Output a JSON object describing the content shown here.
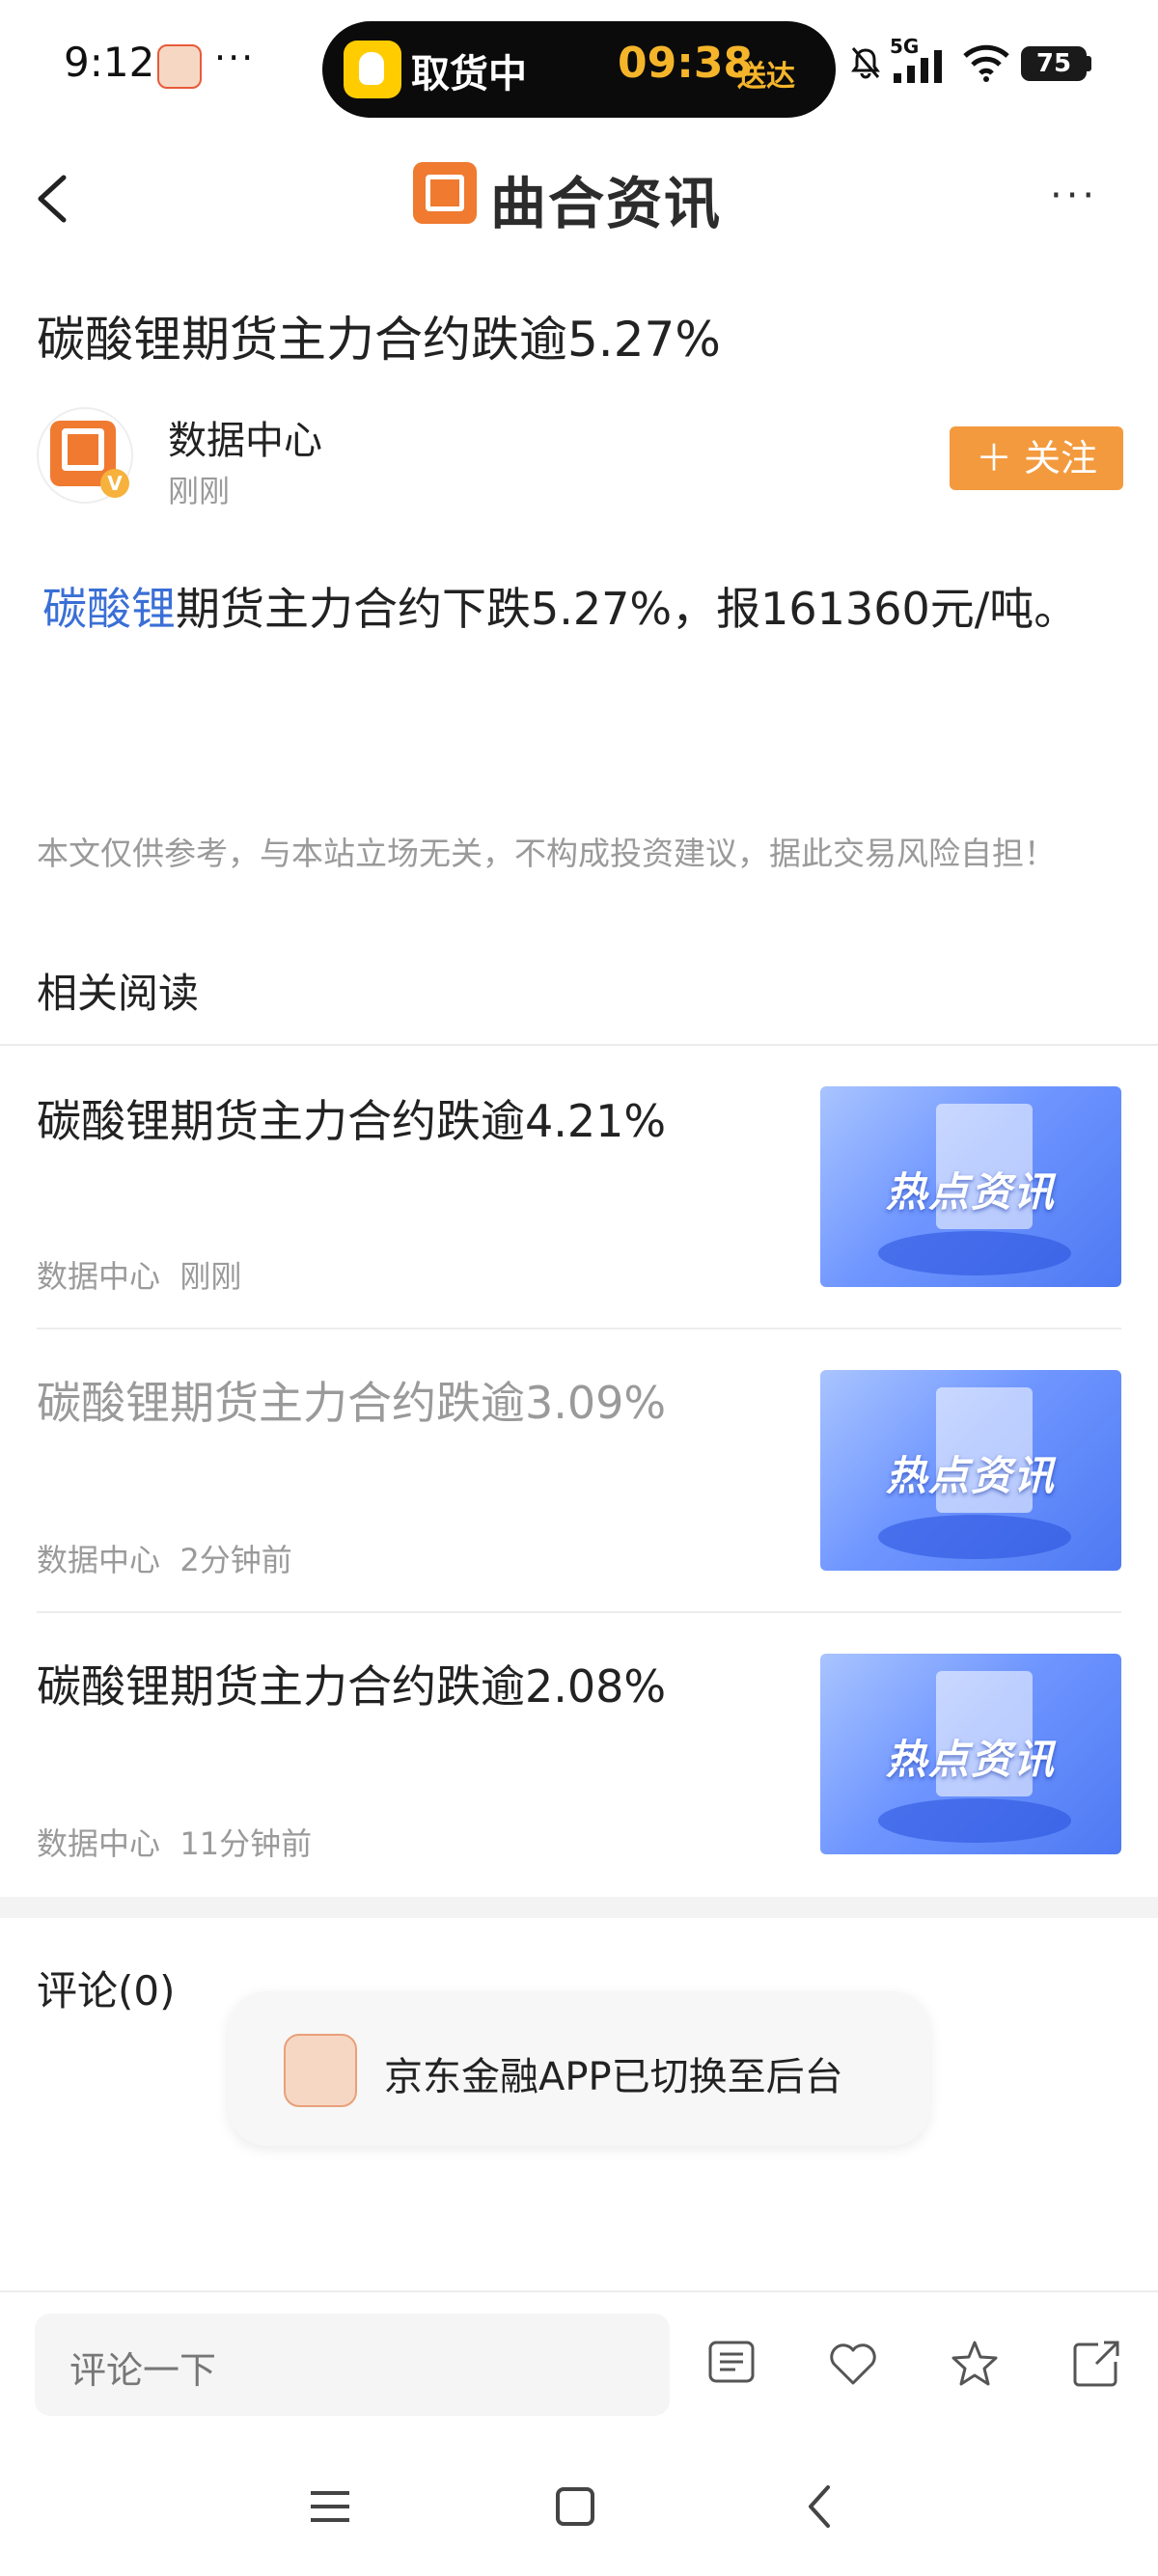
{
  "status_bar": {
    "time": "9:12",
    "dots": "···",
    "island_label": "取货中",
    "island_time": "09:38",
    "island_sub": "送达",
    "network": "5G",
    "battery": "75"
  },
  "header": {
    "brand_name": "曲合资讯",
    "more": "···"
  },
  "article": {
    "title": "碳酸锂期货主力合约跌逾5.27%",
    "author": "数据中心",
    "time": "刚刚",
    "follow_label": "关注",
    "body_link": "碳酸锂",
    "body_rest": "期货主力合约下跌5.27%，报161360元/吨。",
    "disclaimer": "本文仅供参考，与本站立场无关，不构成投资建议，据此交易风险自担！"
  },
  "related": {
    "heading": "相关阅读",
    "items": [
      {
        "title": "碳酸锂期货主力合约跌逾4.21%",
        "source": "数据中心",
        "time": "刚刚",
        "thumb_text": "热点资讯",
        "read": false
      },
      {
        "title": "碳酸锂期货主力合约跌逾3.09%",
        "source": "数据中心",
        "time": "2分钟前",
        "thumb_text": "热点资讯",
        "read": true
      },
      {
        "title": "碳酸锂期货主力合约跌逾2.08%",
        "source": "数据中心",
        "time": "11分钟前",
        "thumb_text": "热点资讯",
        "read": false
      }
    ]
  },
  "comments": {
    "heading": "评论(0)"
  },
  "toast": {
    "text": "京东金融APP已切换至后台"
  },
  "bottom_bar": {
    "placeholder": "评论一下",
    "icons": [
      "comments-icon",
      "like-heart-icon",
      "favorite-star-icon",
      "share-icon"
    ]
  },
  "nav_bar": {
    "icons": [
      "menu-icon",
      "home-square-icon",
      "back-chevron-icon"
    ]
  },
  "colors": {
    "brand_orange": "#f39a3e",
    "link_blue": "#3a6fd6",
    "muted_gray": "#9a9a9a"
  }
}
